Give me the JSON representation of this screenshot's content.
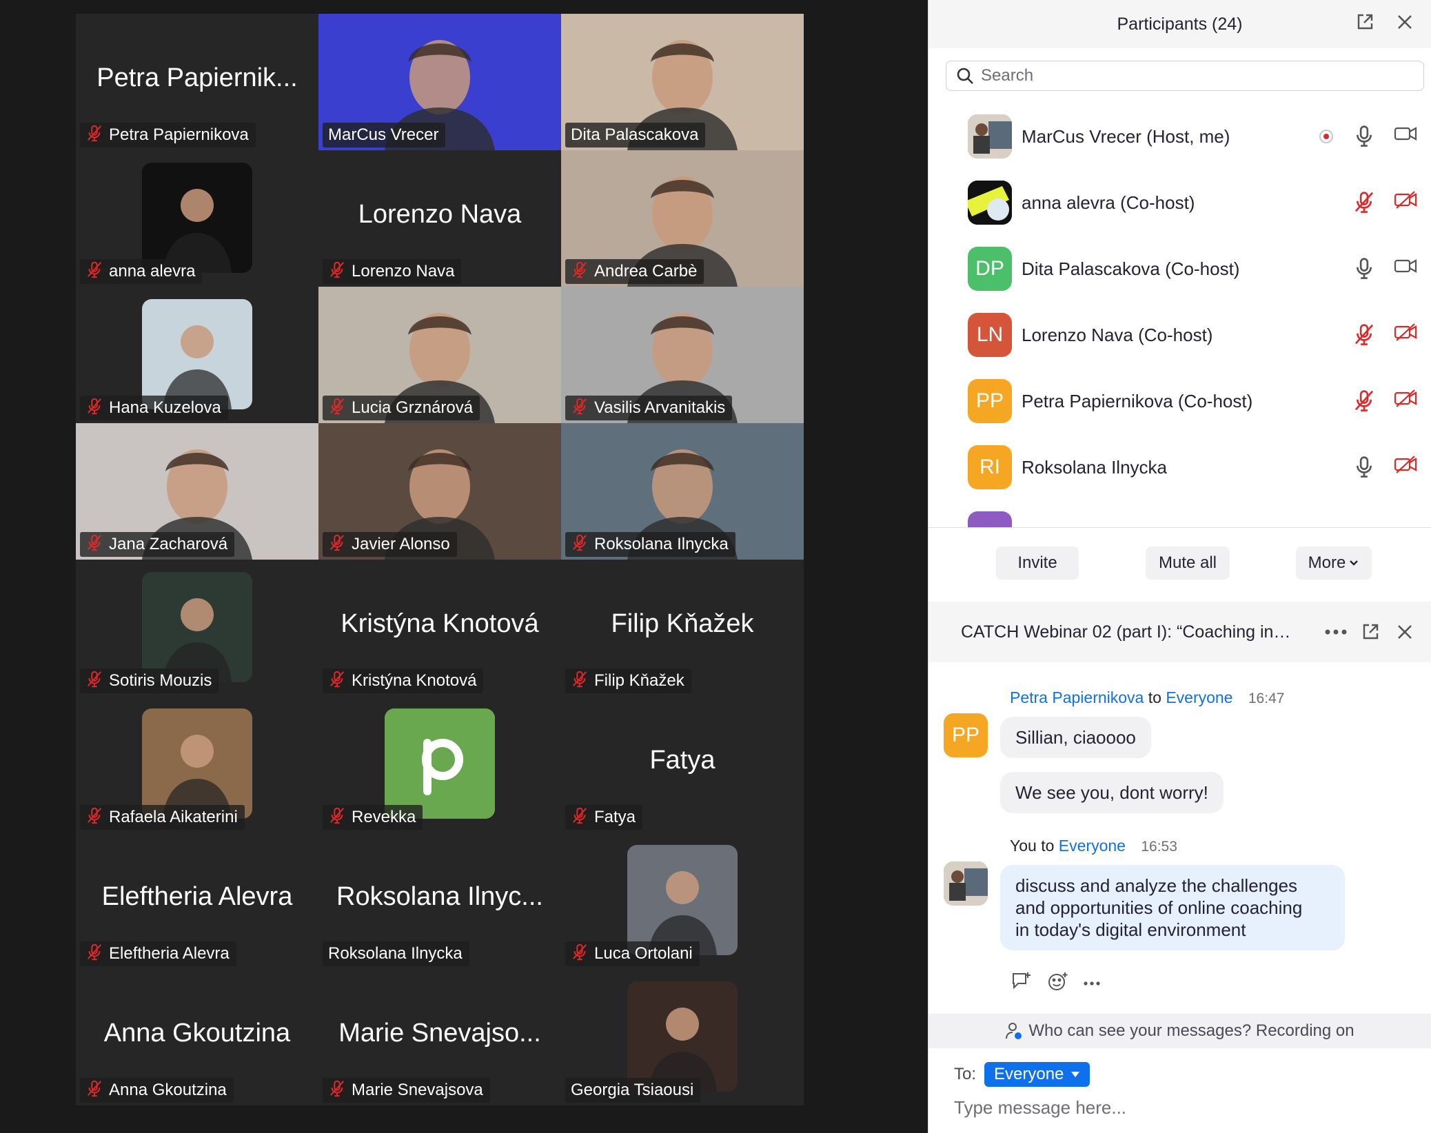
{
  "participants_panel": {
    "title": "Participants (24)",
    "search_placeholder": "Search",
    "list": [
      {
        "name": "MarCus Vrecer (Host, me)",
        "initials": "",
        "color": "#7a6a55",
        "mic": "on",
        "cam": "on",
        "recording": true
      },
      {
        "name": "anna alevra (Co-host)",
        "initials": "",
        "color": "#111111",
        "mic": "muted",
        "cam": "off",
        "recording": false
      },
      {
        "name": "Dita Palascakova (Co-host)",
        "initials": "DP",
        "color": "#4cbf6b",
        "mic": "on",
        "cam": "on",
        "recording": false
      },
      {
        "name": "Lorenzo Nava (Co-host)",
        "initials": "LN",
        "color": "#d5553a",
        "mic": "muted",
        "cam": "off",
        "recording": false
      },
      {
        "name": "Petra Papiernikova (Co-host)",
        "initials": "PP",
        "color": "#f5a623",
        "mic": "muted",
        "cam": "off",
        "recording": false
      },
      {
        "name": "Roksolana Ilnycka",
        "initials": "RI",
        "color": "#f5a623",
        "mic": "on",
        "cam": "off",
        "recording": false
      }
    ],
    "buttons": {
      "invite": "Invite",
      "mute_all": "Mute all",
      "more": "More"
    }
  },
  "chat": {
    "title": "CATCH Webinar 02 (part I): “Coaching in…",
    "messages": [
      {
        "sender": "Petra Papiernikova",
        "to_word": "to",
        "recipient": "Everyone",
        "time": "16:47",
        "avatar_initials": "PP",
        "avatar_color": "#f5a623",
        "lines": [
          "Sillian, ciaoooo",
          "We see you, dont worry!"
        ]
      },
      {
        "sender": "You",
        "to_word": "to",
        "recipient": "Everyone",
        "time": "16:53",
        "lines": [
          "discuss and analyze the challenges",
          "and opportunities of online coaching",
          "in today's digital environment"
        ]
      }
    ],
    "privacy_notice": "Who can see your messages? Recording on",
    "to_label": "To:",
    "to_value": "Everyone",
    "input_placeholder": "Type message here..."
  },
  "gallery": {
    "tiles": [
      {
        "label": "Petra Papiernikova",
        "big": "Petra Papiernik...",
        "type": "name",
        "muted": true
      },
      {
        "label": "MarCus Vrecer",
        "big": "",
        "type": "video",
        "muted": false,
        "bg": "#3a3fd0"
      },
      {
        "label": "Dita Palascakova",
        "big": "",
        "type": "video",
        "muted": false,
        "active": true,
        "bg": "#c9b9a6"
      },
      {
        "label": "anna alevra",
        "big": "",
        "type": "thumb",
        "muted": true,
        "bg": "#111111"
      },
      {
        "label": "Lorenzo Nava",
        "big": "Lorenzo Nava",
        "type": "name",
        "muted": true
      },
      {
        "label": "Andrea Carbè",
        "big": "",
        "type": "video",
        "muted": true,
        "bg": "#b9a99a"
      },
      {
        "label": "Hana Kuzelova",
        "big": "",
        "type": "thumb",
        "muted": true,
        "bg": "#c8d4dc"
      },
      {
        "label": "Lucia Grznárová",
        "big": "",
        "type": "video",
        "muted": true,
        "bg": "#bdb4aa"
      },
      {
        "label": "Vasilis Arvanitakis",
        "big": "",
        "type": "video",
        "muted": true,
        "bg": "#a9a9a9"
      },
      {
        "label": "Jana Zacharová",
        "big": "",
        "type": "video",
        "muted": true,
        "bg": "#c9c4c2"
      },
      {
        "label": "Javier Alonso",
        "big": "",
        "type": "video",
        "muted": true,
        "bg": "#5a4a40"
      },
      {
        "label": "Roksolana Ilnycka",
        "big": "",
        "type": "video",
        "muted": true,
        "bg": "#5f6f7c"
      },
      {
        "label": "Sotiris Mouzis",
        "big": "",
        "type": "thumb",
        "muted": true,
        "bg": "#2d3a33"
      },
      {
        "label": "Kristýna Knotová",
        "big": "Kristýna Knotová",
        "type": "name",
        "muted": true
      },
      {
        "label": "Filip Kňažek",
        "big": "Filip Kňažek",
        "type": "name",
        "muted": true
      },
      {
        "label": "Rafaela Aikaterini",
        "big": "",
        "type": "thumb",
        "muted": true,
        "bg": "#8a6a4a"
      },
      {
        "label": "Revekka",
        "big": "",
        "type": "thumb-p",
        "muted": true,
        "bg": "#6aa84f"
      },
      {
        "label": "Fatya",
        "big": "Fatya",
        "type": "name",
        "muted": true
      },
      {
        "label": "Eleftheria Alevra",
        "big": "Eleftheria Alevra",
        "type": "name",
        "muted": true
      },
      {
        "label": "Roksolana Ilnycka",
        "big": "Roksolana Ilnyc...",
        "type": "name",
        "muted": false
      },
      {
        "label": "Luca Ortolani",
        "big": "",
        "type": "thumb",
        "muted": true,
        "bg": "#6a6f78"
      },
      {
        "label": "Anna Gkoutzina",
        "big": "Anna Gkoutzina",
        "type": "name",
        "muted": true
      },
      {
        "label": "Marie Snevajsova",
        "big": "Marie Snevajso...",
        "type": "name",
        "muted": true
      },
      {
        "label": "Georgia Tsiaousi",
        "big": "",
        "type": "thumb",
        "muted": false,
        "bg": "#3a2a25"
      }
    ]
  },
  "colors": {
    "accent": "#0e71eb",
    "active_speaker": "#23d959",
    "muted_red": "#e02828"
  }
}
